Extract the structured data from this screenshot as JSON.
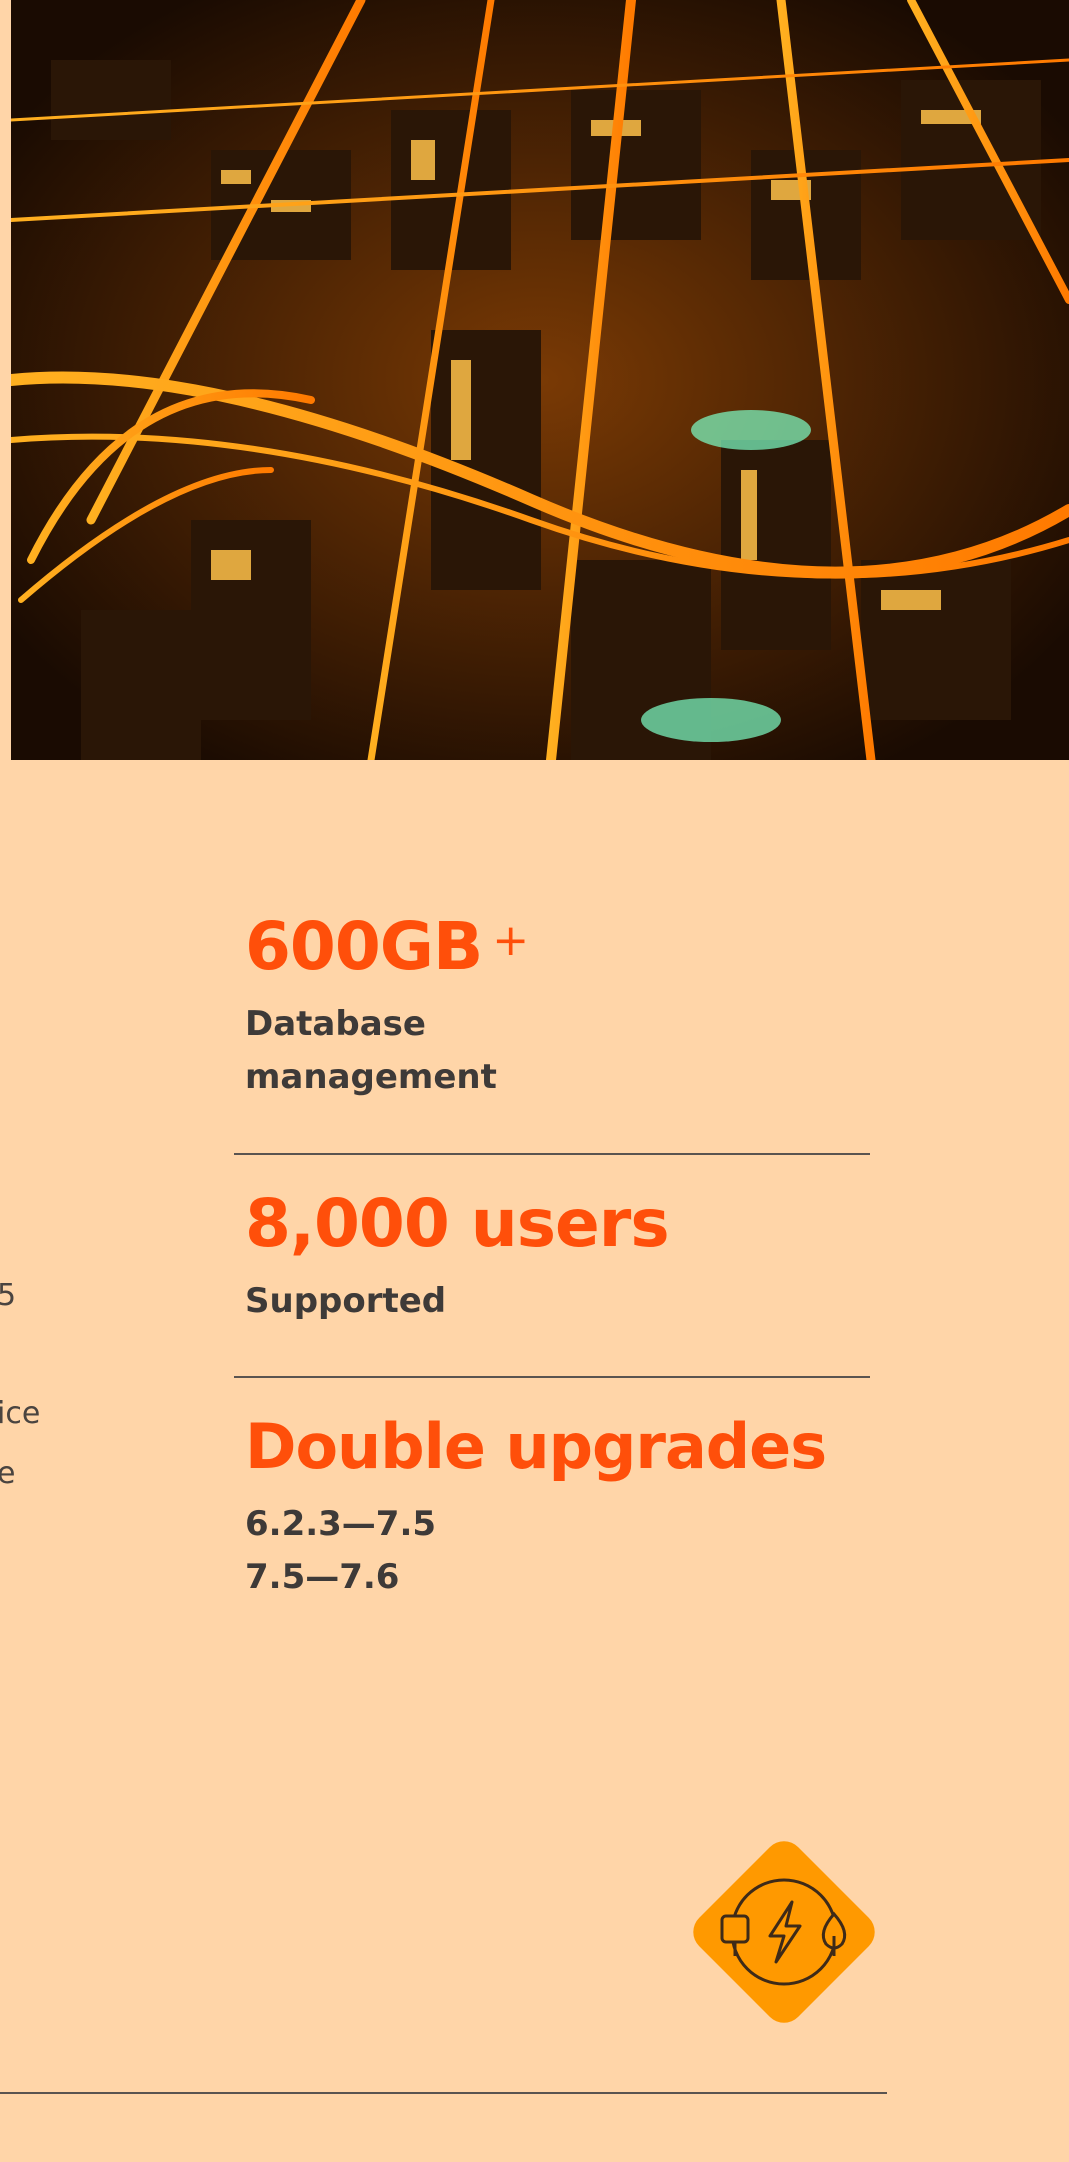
{
  "hero_image": {
    "subject": "city-night-aerial-photo"
  },
  "stats": [
    {
      "value": "600GB",
      "suffix": "+",
      "caption_lines": [
        "Database",
        "management"
      ]
    },
    {
      "value": "8,000 users",
      "suffix": "",
      "caption_lines": [
        "Supported"
      ]
    },
    {
      "value": "Double upgrades",
      "suffix": "",
      "caption_lines": [
        "6.2.3—7.5",
        "7.5—7.6"
      ]
    }
  ],
  "clipped_left_text": [
    "5",
    "ice",
    "e"
  ],
  "badge": {
    "icon": "plug-lightning-leaf-icon",
    "color": "#FF9900"
  },
  "colors": {
    "background": "#FFD5A8",
    "accent": "#FF4F0A",
    "text": "#3E3A38"
  }
}
